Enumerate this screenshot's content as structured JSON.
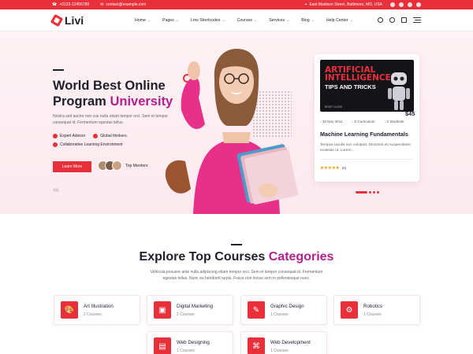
{
  "topbar": {
    "phone": "+0123-12456789",
    "email": "contact@example.com",
    "address": "East Madison Street, Baltimore, MD, USA"
  },
  "nav": {
    "logo": "Livi",
    "menu": [
      "Home",
      "Pages",
      "Lms Shortcodes",
      "Courses",
      "Services",
      "Blog",
      "Help Center"
    ]
  },
  "hero": {
    "title_part1": "World Best Online Program",
    "title_highlight": "University",
    "description": "Nostra sed auctor non cus nulla etiam tempor orci. Sem et tempor consequat id. Fermentum egestas tellus.",
    "checks": [
      "Expert Advisor",
      "Global thinkers.",
      "Collaborative Learning Environment"
    ],
    "learn_button": "Learn More",
    "mentors_label": "Top Mentors",
    "arrows": "‹‹‹"
  },
  "course_card": {
    "image_title": "ARTIFICIAL INTELLIGENCE",
    "image_subtitle": "TIPS AND TRICKS",
    "image_footer": "BRIEF GUIDE",
    "date": "30 Nov 2011",
    "curriculum": "5 Curriculum",
    "students": "2 Students",
    "title": "Machine Learning Fundamentals",
    "description": "Tempus iaculis non volutpat. Dictumst eu suspendisse molestie ut. Lorem...",
    "stars": "★★★★★",
    "rating_count": "(6)",
    "price": "$45"
  },
  "categories": {
    "title_part1": "Explore Top Courses",
    "title_highlight": "Categories",
    "description": "Vehicula posuere ante nulla adipiscing etiam tempor orci. Sem et tempor consequat id. Fermentum egestas tellus. Nunc eu hendrerit turpis. Fusce non lectus sem in pellentesque nunc.",
    "items": [
      {
        "name": "Art Illustration",
        "count": "2 Courses",
        "icon": "palette-icon",
        "glyph": "🎨"
      },
      {
        "name": "Digital Marketing",
        "count": "2 Courses",
        "icon": "monitor-icon",
        "glyph": "▣"
      },
      {
        "name": "Graphic Design",
        "count": "1 Courses",
        "icon": "pen-tool-icon",
        "glyph": "✎"
      },
      {
        "name": "Robotics",
        "count": "1 Courses",
        "icon": "robot-icon",
        "glyph": "⚙"
      },
      {
        "name": "Web Designing",
        "count": "1 Courses",
        "icon": "web-design-icon",
        "glyph": "▤"
      },
      {
        "name": "Web Development",
        "count": "1 Courses",
        "icon": "code-icon",
        "glyph": "⌘"
      }
    ]
  },
  "colors": {
    "accent": "#e8303a",
    "highlight": "#b0208f",
    "hero_bg": "#fbecf1"
  }
}
